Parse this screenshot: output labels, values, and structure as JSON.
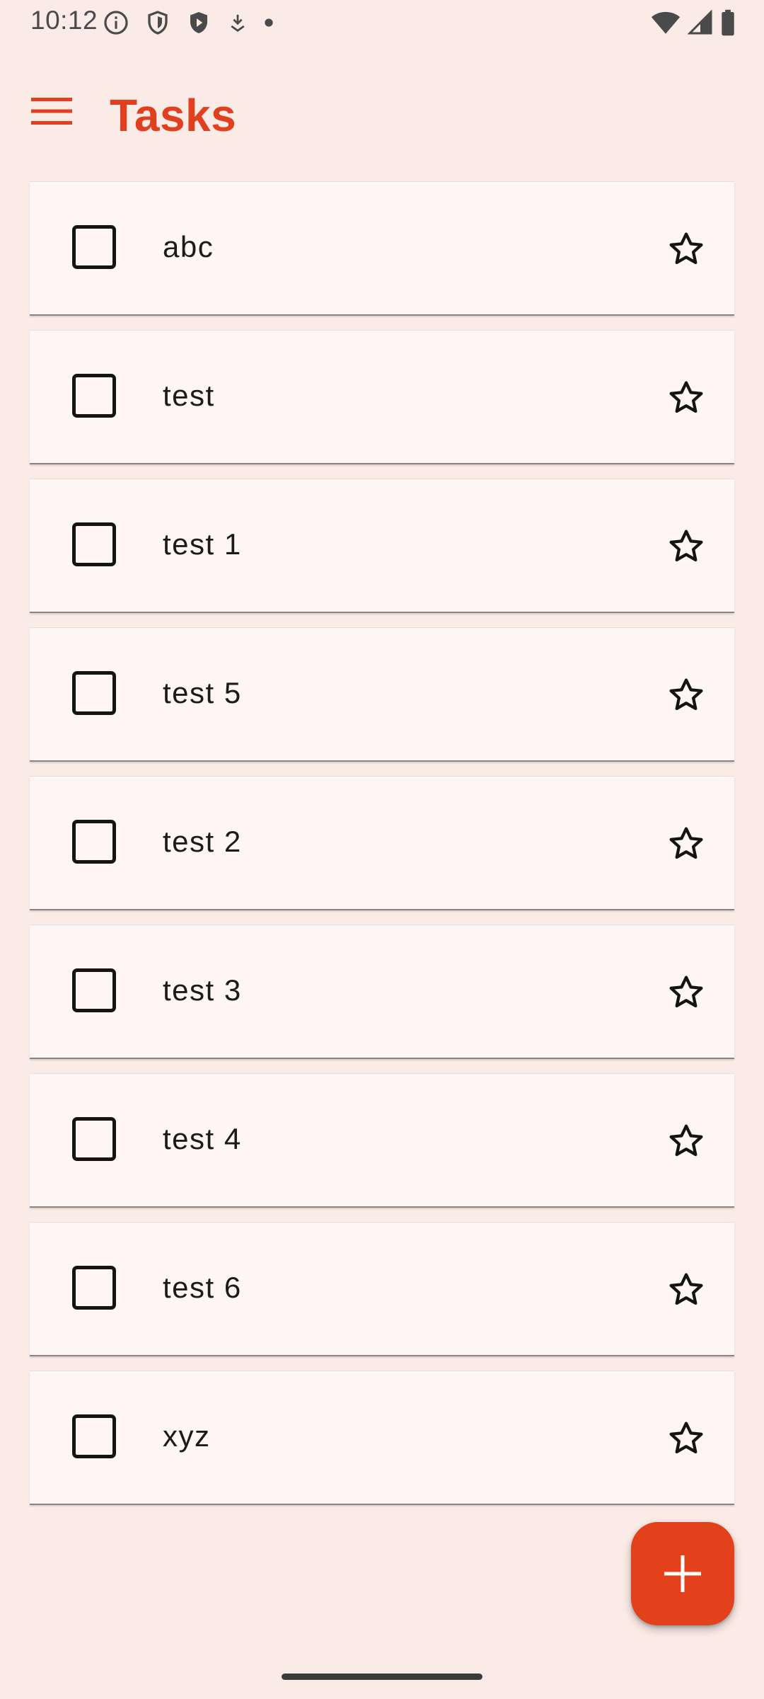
{
  "status_bar": {
    "time": "10:12",
    "left_icons": [
      "info-icon",
      "shield-icon",
      "play-shield-icon",
      "download-icon",
      "dot-icon"
    ],
    "right_icons": [
      "wifi-icon",
      "signal-icon",
      "battery-icon"
    ]
  },
  "app_bar": {
    "title": "Tasks",
    "menu_icon": "menu-icon"
  },
  "tasks": [
    {
      "label": "abc",
      "checked": false,
      "starred": false
    },
    {
      "label": "test",
      "checked": false,
      "starred": false
    },
    {
      "label": "test 1",
      "checked": false,
      "starred": false
    },
    {
      "label": "test 5",
      "checked": false,
      "starred": false
    },
    {
      "label": "test 2",
      "checked": false,
      "starred": false
    },
    {
      "label": "test 3",
      "checked": false,
      "starred": false
    },
    {
      "label": "test 4",
      "checked": false,
      "starred": false
    },
    {
      "label": "test 6",
      "checked": false,
      "starred": false
    },
    {
      "label": "xyz",
      "checked": false,
      "starred": false
    }
  ],
  "fab": {
    "icon": "plus-icon"
  },
  "colors": {
    "accent": "#E0401F",
    "background": "#FBEBE7",
    "card": "#FEF5F5"
  }
}
